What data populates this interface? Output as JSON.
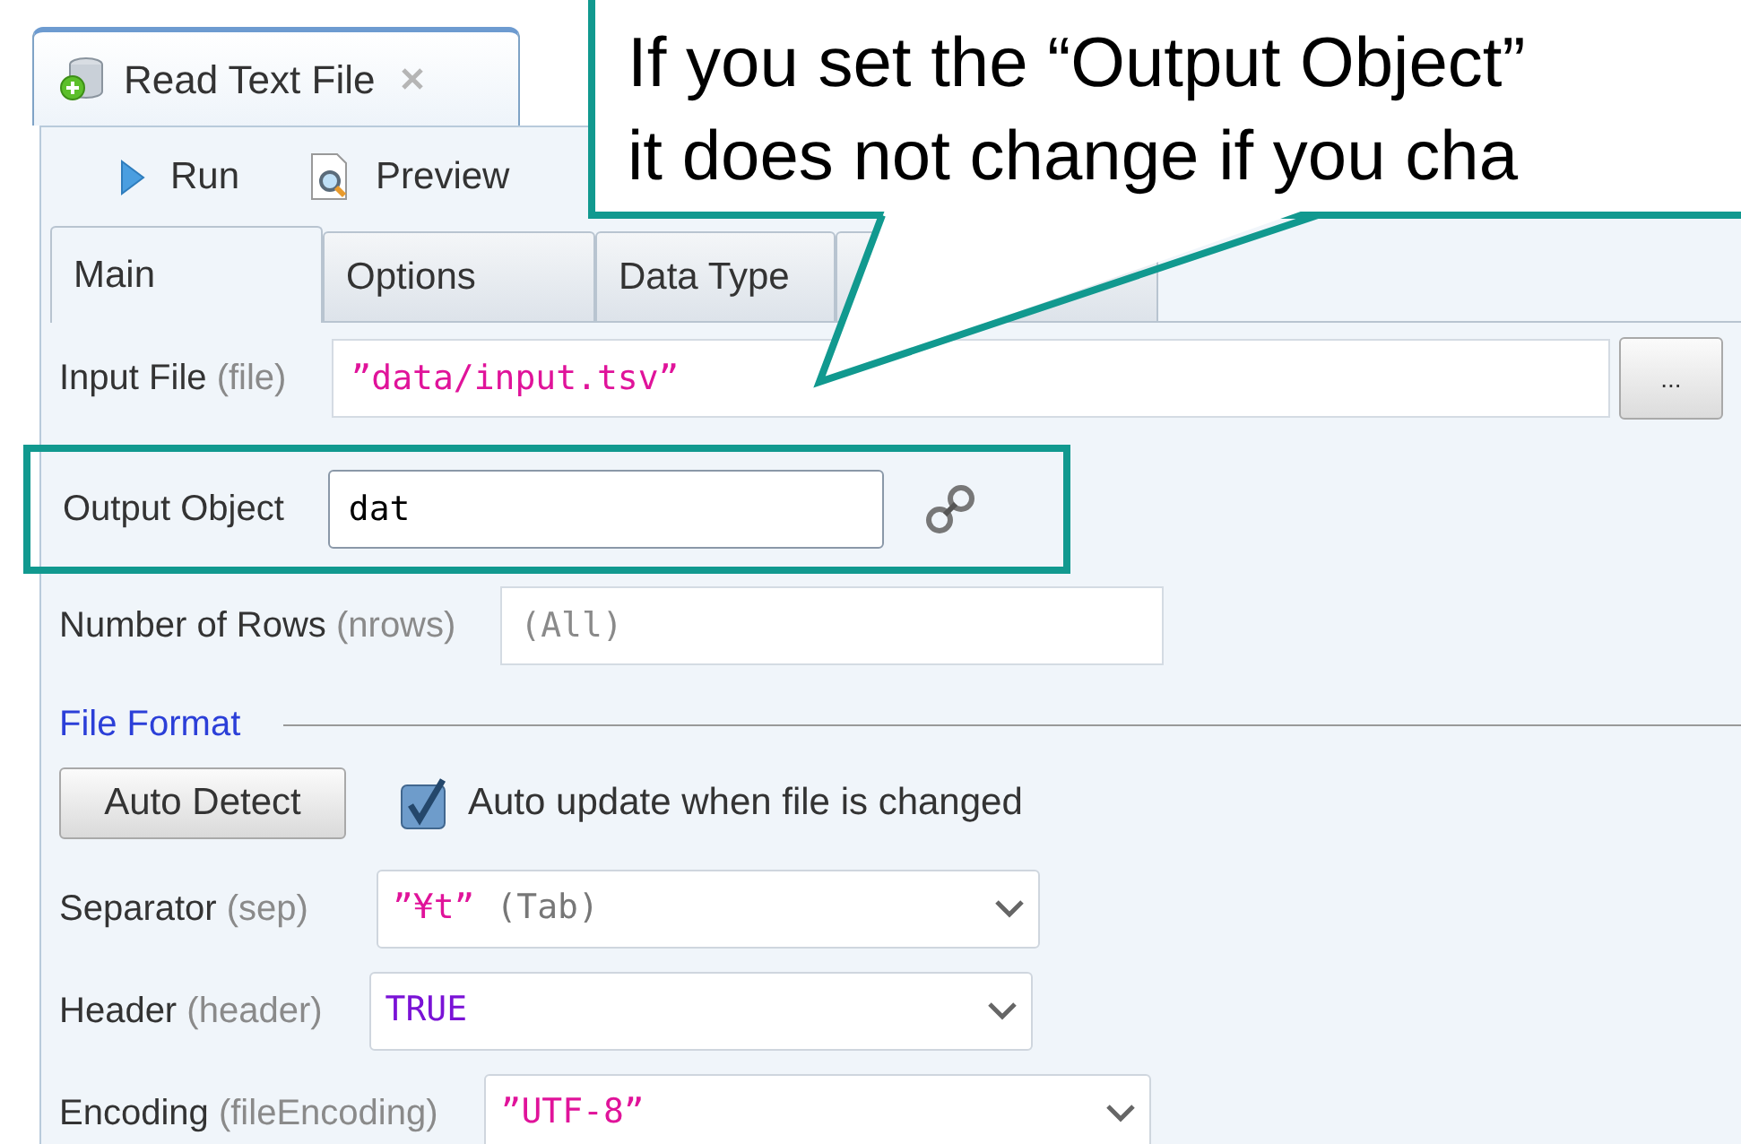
{
  "editor_tab": {
    "title": "Read Text File"
  },
  "toolbar": [
    {
      "kind": "run",
      "label": "Run"
    },
    {
      "kind": "preview",
      "label": "Preview"
    }
  ],
  "tabs": [
    {
      "label": "Main",
      "selected": true
    },
    {
      "label": "Options",
      "selected": false
    },
    {
      "label": "Data Type",
      "selected": false
    }
  ],
  "fields": [
    {
      "kind": "file",
      "label": "Input File",
      "param": "(file)",
      "value": {
        "text": "”data/input.tsv”",
        "kind": "string"
      },
      "button": "...",
      "highlighted": false
    },
    {
      "kind": "object",
      "label": "Output Object",
      "value": {
        "text": "dat",
        "kind": "plain"
      },
      "highlighted": true
    },
    {
      "kind": "number",
      "label": "Number of Rows",
      "param": "(nrows)",
      "placeholder": "(All)",
      "highlighted": false
    }
  ],
  "section": {
    "title": "File Format"
  },
  "auto_detect": {
    "label": "Auto Detect"
  },
  "auto_update": {
    "label": "Auto update when file is changed",
    "checked": true
  },
  "selects": [
    {
      "label": "Separator",
      "param": "(sep)",
      "value": {
        "text": "”¥t”",
        "kind": "string"
      },
      "note": "(Tab)"
    },
    {
      "label": "Header",
      "param": "(header)",
      "value": {
        "text": "TRUE",
        "kind": "constant"
      }
    },
    {
      "label": "Encoding",
      "param": "(fileEncoding)",
      "value": {
        "text": "”UTF-8”",
        "kind": "string"
      }
    }
  ],
  "callout": {
    "lines": [
      "If you set the “Output Object”",
      "it does not change if you cha"
    ]
  }
}
